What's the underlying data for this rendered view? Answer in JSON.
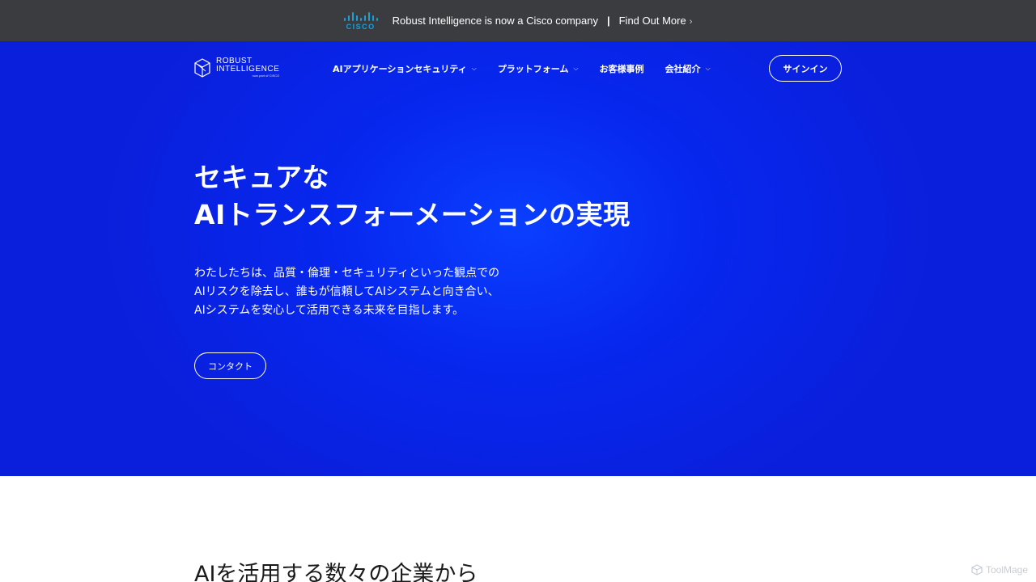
{
  "announcement": {
    "cisco_word": "CISCO",
    "text": "Robust Intelligence is now a Cisco company",
    "separator": "|",
    "link": "Find Out More",
    "link_chevron": "›"
  },
  "brand": {
    "line1": "ROBUST",
    "line2": "INTELLIGENCE",
    "line3": "now part of CISCO",
    "icon": "hexagon-cube-icon"
  },
  "nav": {
    "items": [
      {
        "label": "AIアプリケーションセキュリティ",
        "has_dropdown": true
      },
      {
        "label": "プラットフォーム",
        "has_dropdown": true
      },
      {
        "label": "お客様事例",
        "has_dropdown": false
      },
      {
        "label": "会社紹介",
        "has_dropdown": true
      }
    ],
    "caret": "⌵",
    "signin": "サインイン"
  },
  "hero": {
    "title_line1": "セキュアな",
    "title_line2": "AIトランスフォーメーションの実現",
    "desc_line1": "わたしたちは、品質・倫理・セキュリティといった観点での",
    "desc_line2": "AIリスクを除去し、誰もが信頼してAIシステムと向き合い、",
    "desc_line3": "AIシステムを安心して活用できる未来を目指します。",
    "contact": "コンタクト"
  },
  "section": {
    "heading": "AIを活用する数々の企業から"
  },
  "watermark": {
    "text": "ToolMage"
  },
  "colors": {
    "announce_bg": "#3a3c40",
    "cisco_blue": "#1ba0d7",
    "hero_blue": "#0727ee"
  }
}
